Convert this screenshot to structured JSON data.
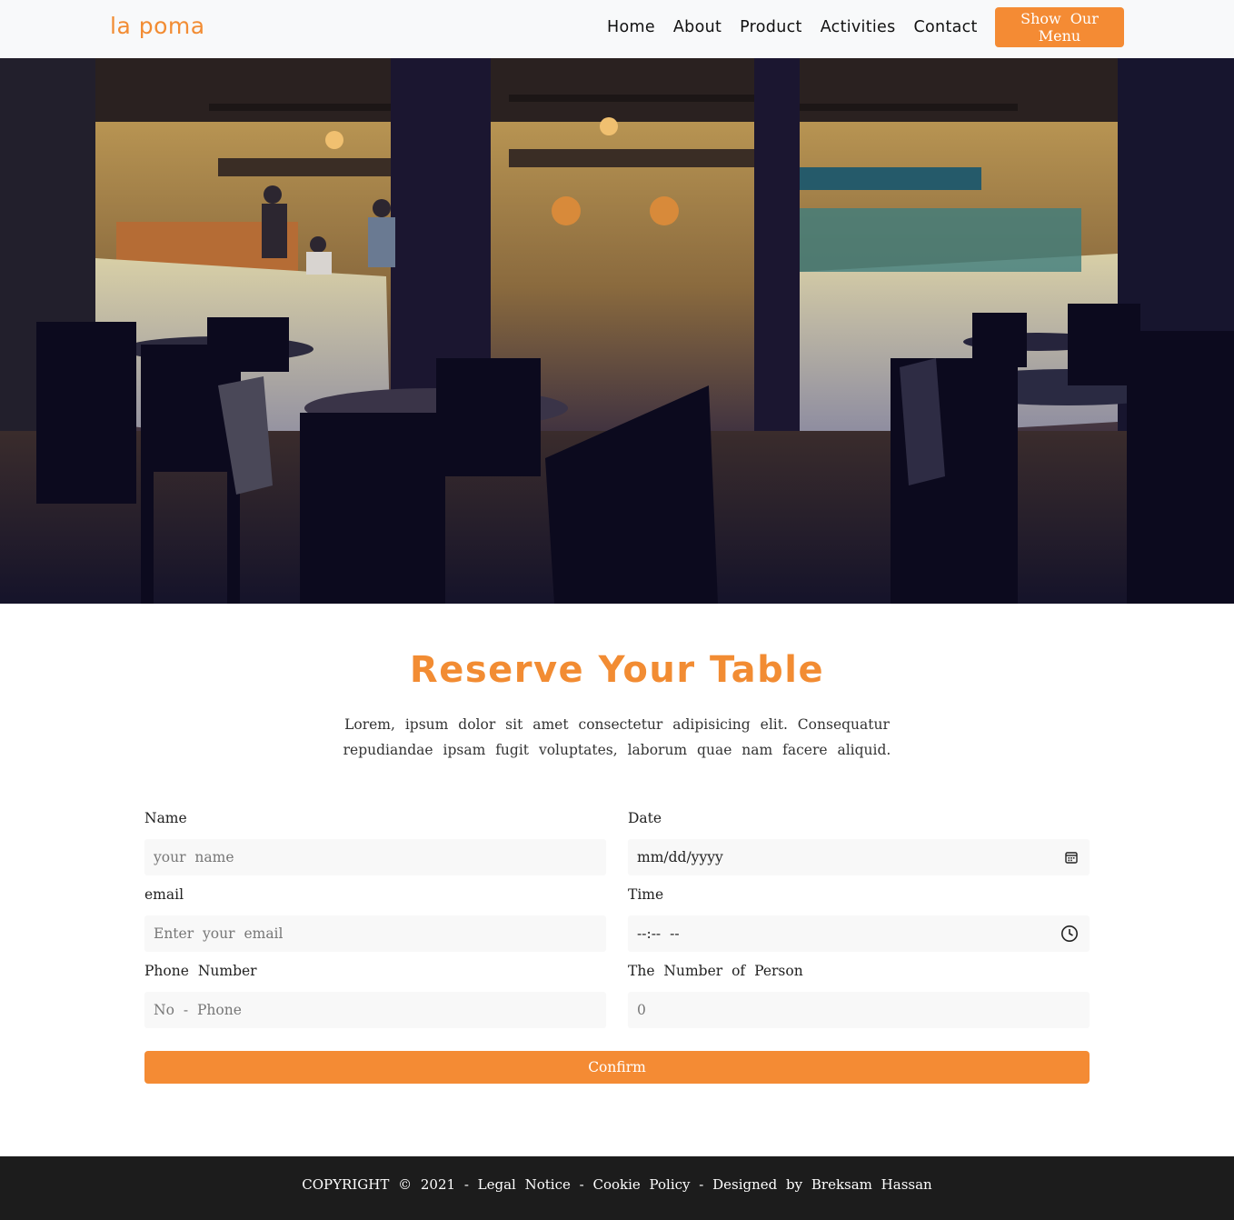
{
  "navbar": {
    "brand": "la poma",
    "links": [
      "Home",
      "About",
      "Product",
      "Activities",
      "Contact"
    ],
    "menu_button": "Show Our Menu"
  },
  "hero": {
    "image_icon": "restaurant-interior-photo"
  },
  "reservation": {
    "title": "Reserve Your Table",
    "intro": "Lorem, ipsum dolor sit amet consectetur adipisicing elit. Consequatur repudiandae ipsam fugit voluptates, laborum quae nam facere aliquid.",
    "fields": {
      "name": {
        "label": "Name",
        "placeholder": "your name"
      },
      "email": {
        "label": "email",
        "placeholder": "Enter your email"
      },
      "phone": {
        "label": "Phone Number",
        "placeholder": "No - Phone"
      },
      "date": {
        "label": "Date",
        "value": "mm/dd/yyyy",
        "icon": "calendar-icon"
      },
      "time": {
        "label": "Time",
        "value": "--:-- --",
        "icon": "clock-icon"
      },
      "persons": {
        "label": "The Number of Person",
        "placeholder": "0"
      }
    },
    "confirm_label": "Confirm"
  },
  "footer": {
    "text": "COPYRIGHT © 2021 - Legal Notice - Cookie Policy - Designed by Breksam Hassan"
  },
  "colors": {
    "accent": "#f48b34",
    "navbar_bg": "#f8f9fa",
    "footer_bg": "#1c1c1c",
    "input_bg": "#f8f8f8"
  }
}
